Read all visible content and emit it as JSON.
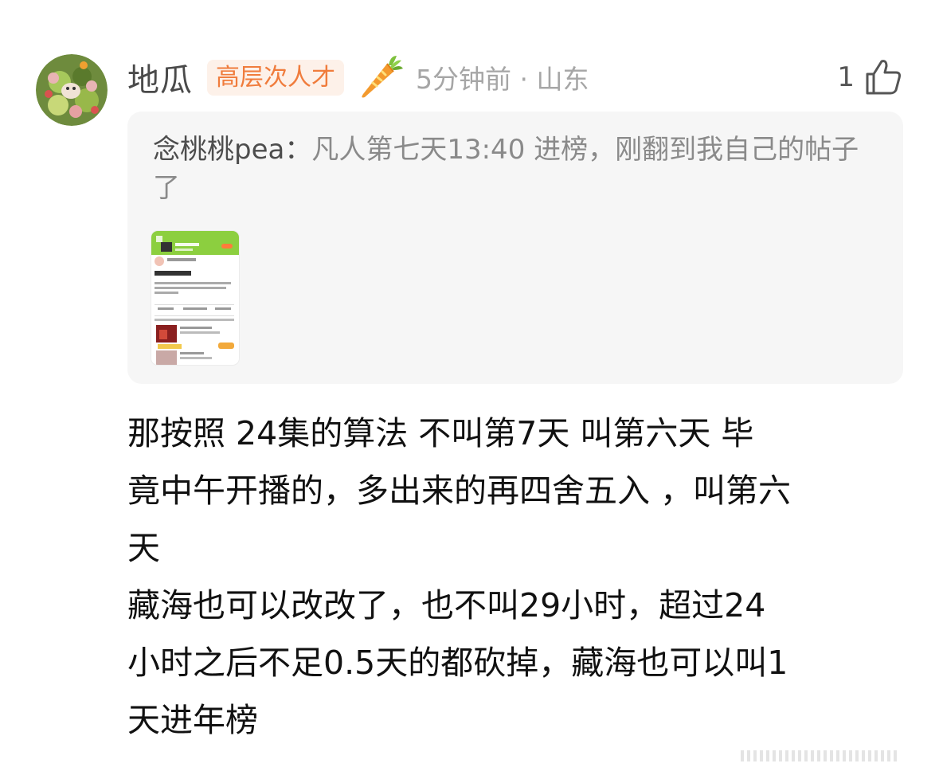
{
  "comment": {
    "username": "地瓜",
    "badge_label": "高层次人才",
    "time_location": "5分钟前 · 山东",
    "like_count": "1",
    "quote": {
      "author": "念桃桃pea：",
      "text": "凡人第七天13:40 进榜，刚翻到我自己的帖子了"
    },
    "body_lines": [
      "那按照 24集的算法  不叫第7天  叫第六天 毕",
      "竟中午开播的，多出来的再四舍五入 ，叫第六",
      "天",
      "藏海也可以改改了，也不叫29小时，超过24",
      "小时之后不足0.5天的都砍掉，藏海也可以叫1",
      "天进年榜"
    ]
  },
  "icons": {
    "avatar": "salad-avatar",
    "badge_icon": "carrot-icon",
    "like": "thumbs-up-icon"
  },
  "colors": {
    "badge_text": "#f07c3c",
    "badge_bg": "#fdf1e9",
    "quote_bg": "#f6f6f6",
    "meta_text": "#a6a6a6",
    "thumb_header_green": "#8ccf3f"
  }
}
